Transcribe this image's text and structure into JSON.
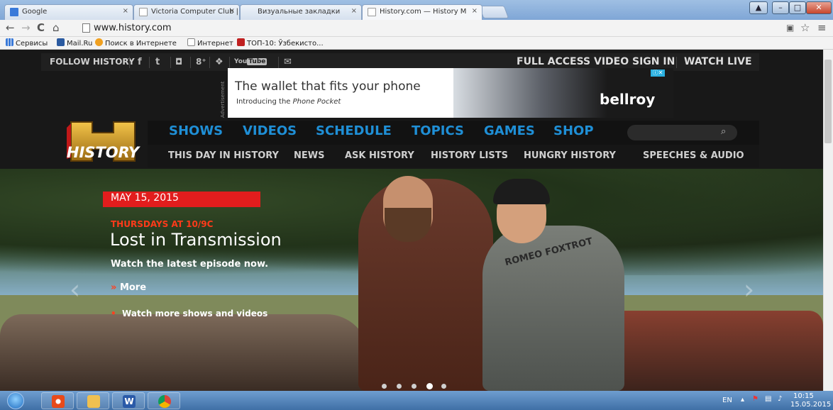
{
  "browser": {
    "tabs": [
      {
        "label": "Google",
        "active": false
      },
      {
        "label": "Victoria Computer Club | ",
        "active": false
      },
      {
        "label": "Визуальные закладки",
        "active": false
      },
      {
        "label": "History.com — History M",
        "active": true
      }
    ],
    "url": "www.history.com",
    "nav": {
      "back": "←",
      "forward": "→",
      "reload": "C",
      "home": "⌂"
    },
    "bookmarks": [
      {
        "label": "Сервисы",
        "icon": "apps-icon"
      },
      {
        "label": "Mail.Ru",
        "icon": "mailru-icon"
      },
      {
        "label": "Поиск в Интернете",
        "icon": "search-icon"
      },
      {
        "label": "Интернет",
        "icon": "page-icon"
      },
      {
        "label": "ТОП-10: Ўзбекисто...",
        "icon": "top10-icon"
      }
    ]
  },
  "site": {
    "follow_label": "FOLLOW HISTORY",
    "social": [
      "f",
      "t",
      "ig",
      "8+",
      "v",
      "YouTube",
      "mail"
    ],
    "top_right": [
      "FULL ACCESS VIDEO SIGN IN",
      "WATCH LIVE"
    ],
    "ad": {
      "label": "Advertisement",
      "headline": "The wallet that fits your phone",
      "sub_prefix": "Introducing the ",
      "sub_em": "Phone Pocket",
      "brand": "bellroy"
    },
    "logo_text": "HISTORY",
    "main_nav": [
      "SHOWS",
      "VIDEOS",
      "SCHEDULE",
      "TOPICS",
      "GAMES",
      "SHOP"
    ],
    "sub_nav": [
      "THIS DAY IN HISTORY",
      "NEWS",
      "ASK HISTORY",
      "HISTORY LISTS",
      "HUNGRY HISTORY",
      "SPEECHES & AUDIO"
    ],
    "hero": {
      "date": "MAY 15, 2015",
      "airtime": "THURSDAYS AT 10/9C",
      "title": "Lost in Transmission",
      "watch": "Watch the latest episode now.",
      "more": "More",
      "watch_more": "Watch more shows and videos",
      "shirt_text": "ROMEO FOXTROT",
      "slides_total": 5,
      "active_slide": 4
    }
  },
  "taskbar": {
    "apps": [
      "Opera",
      "Files",
      "Word",
      "Chrome"
    ],
    "lang": "EN",
    "time": "10:15",
    "date": "15.05.2015"
  },
  "colors": {
    "accent_blue": "#1f8fd6",
    "history_red": "#e21d1d",
    "gold": "#c8941e"
  }
}
